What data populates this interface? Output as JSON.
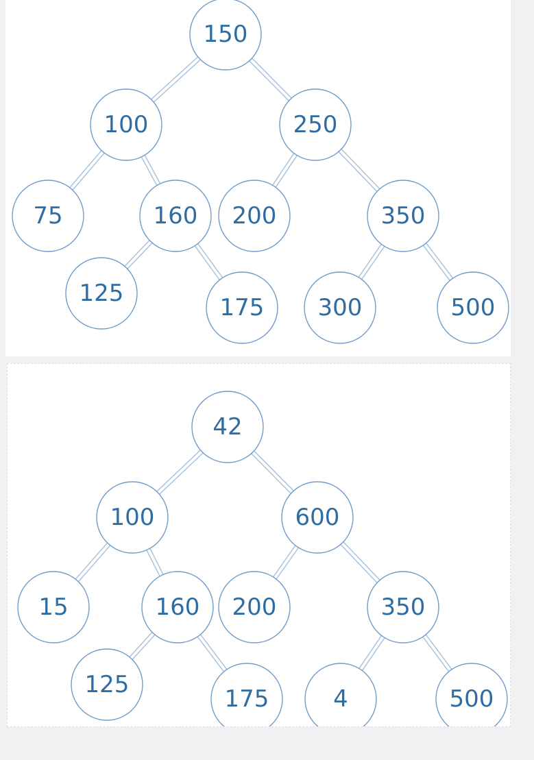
{
  "trees": [
    {
      "id": "top",
      "nodes": [
        {
          "id": "n150",
          "label": "150"
        },
        {
          "id": "n100",
          "label": "100"
        },
        {
          "id": "n250",
          "label": "250"
        },
        {
          "id": "n75",
          "label": "75"
        },
        {
          "id": "n160",
          "label": "160"
        },
        {
          "id": "n200",
          "label": "200"
        },
        {
          "id": "n350",
          "label": "350"
        },
        {
          "id": "n125",
          "label": "125"
        },
        {
          "id": "n175",
          "label": "175"
        },
        {
          "id": "n300",
          "label": "300"
        },
        {
          "id": "n500",
          "label": "500"
        }
      ],
      "edges": [
        [
          "n150",
          "n100"
        ],
        [
          "n150",
          "n250"
        ],
        [
          "n100",
          "n75"
        ],
        [
          "n100",
          "n160"
        ],
        [
          "n250",
          "n200"
        ],
        [
          "n250",
          "n350"
        ],
        [
          "n160",
          "n125"
        ],
        [
          "n160",
          "n175"
        ],
        [
          "n350",
          "n300"
        ],
        [
          "n350",
          "n500"
        ]
      ]
    },
    {
      "id": "bottom",
      "nodes": [
        {
          "id": "m42",
          "label": "42"
        },
        {
          "id": "m100",
          "label": "100"
        },
        {
          "id": "m600",
          "label": "600"
        },
        {
          "id": "m15",
          "label": "15"
        },
        {
          "id": "m160",
          "label": "160"
        },
        {
          "id": "m200",
          "label": "200"
        },
        {
          "id": "m350",
          "label": "350"
        },
        {
          "id": "m125",
          "label": "125"
        },
        {
          "id": "m175",
          "label": "175"
        },
        {
          "id": "m4",
          "label": "4"
        },
        {
          "id": "m500",
          "label": "500"
        }
      ],
      "edges": [
        [
          "m42",
          "m100"
        ],
        [
          "m42",
          "m600"
        ],
        [
          "m100",
          "m15"
        ],
        [
          "m100",
          "m160"
        ],
        [
          "m600",
          "m200"
        ],
        [
          "m600",
          "m350"
        ],
        [
          "m160",
          "m125"
        ],
        [
          "m160",
          "m175"
        ],
        [
          "m350",
          "m4"
        ],
        [
          "m350",
          "m500"
        ]
      ]
    }
  ]
}
